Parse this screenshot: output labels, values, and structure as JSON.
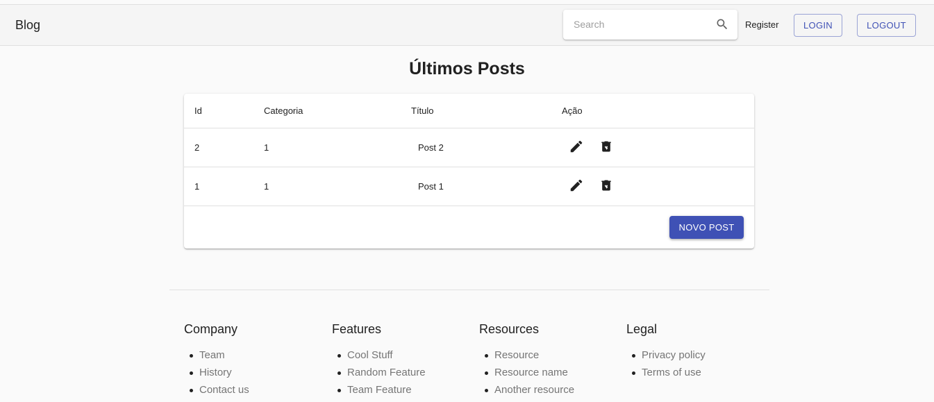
{
  "header": {
    "brand": "Blog",
    "search_placeholder": "Search",
    "register_label": "Register",
    "login_label": "LOGIN",
    "logout_label": "LOGOUT"
  },
  "main": {
    "title": "Últimos Posts",
    "columns": [
      "Id",
      "Categoria",
      "Título",
      "Ação"
    ],
    "rows": [
      {
        "id": "2",
        "categoria": "1",
        "titulo": "Post 2"
      },
      {
        "id": "1",
        "categoria": "1",
        "titulo": "Post 1"
      }
    ],
    "new_post_label": "NOVO POST"
  },
  "footer": {
    "columns": [
      {
        "title": "Company",
        "items": [
          "Team",
          "History",
          "Contact us"
        ]
      },
      {
        "title": "Features",
        "items": [
          "Cool Stuff",
          "Random Feature",
          "Team Feature"
        ]
      },
      {
        "title": "Resources",
        "items": [
          "Resource",
          "Resource name",
          "Another resource"
        ]
      },
      {
        "title": "Legal",
        "items": [
          "Privacy policy",
          "Terms of use"
        ]
      }
    ]
  },
  "colors": {
    "primary": "#3f51b5",
    "background": "#fafafa",
    "appbar": "#f5f5f5"
  },
  "icons": [
    "search-icon",
    "edit-icon",
    "delete-icon"
  ]
}
